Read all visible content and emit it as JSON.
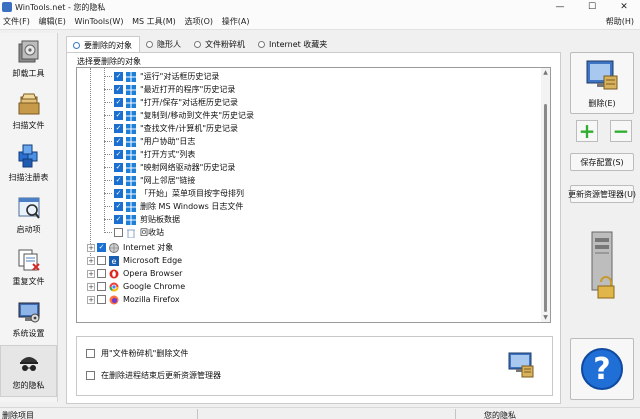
{
  "window": {
    "title": "WinTools.net - 您的隐私",
    "min": "—",
    "max": "☐",
    "close": "✕"
  },
  "menu": {
    "items": [
      "文件(F)",
      "编辑(E)",
      "WinTools(W)",
      "MS 工具(M)",
      "选项(O)",
      "操作(A)"
    ],
    "help": "帮助(H)"
  },
  "sidebar": {
    "items": [
      {
        "label": "卸载工具",
        "icon": "uninstall-icon"
      },
      {
        "label": "扫描文件",
        "icon": "scan-files-icon"
      },
      {
        "label": "扫描注册表",
        "icon": "scan-registry-icon"
      },
      {
        "label": "启动项",
        "icon": "startup-icon"
      },
      {
        "label": "重复文件",
        "icon": "duplicate-files-icon"
      },
      {
        "label": "系统设置",
        "icon": "system-settings-icon"
      },
      {
        "label": "您的隐私",
        "icon": "privacy-icon"
      }
    ]
  },
  "tabs": [
    {
      "label": "要删除的对象",
      "active": true
    },
    {
      "label": "隐形人",
      "active": false
    },
    {
      "label": "文件粉碎机",
      "active": false
    },
    {
      "label": "Internet 收藏夹",
      "active": false
    }
  ],
  "group_title": "选择要删除的对象",
  "tree": {
    "windows_items": [
      {
        "label": "\"运行\"对话框历史记录",
        "checked": true
      },
      {
        "label": "\"最近打开的程序\"历史记录",
        "checked": true
      },
      {
        "label": "\"打开/保存\"对话框历史记录",
        "checked": true
      },
      {
        "label": "\"复制到/移动到文件夹\"历史记录",
        "checked": true
      },
      {
        "label": "\"查找文件/计算机\"历史记录",
        "checked": true
      },
      {
        "label": "\"用户协助\"日志",
        "checked": true
      },
      {
        "label": "\"打开方式\"列表",
        "checked": true
      },
      {
        "label": "\"映射网络驱动器\"历史记录",
        "checked": true
      },
      {
        "label": "\"网上邻居\"链接",
        "checked": true
      },
      {
        "label": "「开始」菜单项目按字母排列",
        "checked": true
      },
      {
        "label": "删除 MS Windows 日志文件",
        "checked": true
      },
      {
        "label": "剪贴板数据",
        "checked": true
      },
      {
        "label": "回收站",
        "checked": false
      }
    ],
    "browsers": [
      {
        "label": "Internet 对象",
        "checked": true,
        "icon": "internet-objects-icon"
      },
      {
        "label": "Microsoft Edge",
        "checked": false,
        "icon": "edge-icon"
      },
      {
        "label": "Opera Browser",
        "checked": false,
        "icon": "opera-icon"
      },
      {
        "label": "Google Chrome",
        "checked": false,
        "icon": "chrome-icon"
      },
      {
        "label": "Mozilla Firefox",
        "checked": false,
        "icon": "firefox-icon"
      }
    ],
    "checkmark": "✓"
  },
  "options": [
    {
      "label": "用\"文件粉碎机\"删除文件",
      "checked": false
    },
    {
      "label": "在删除进程结束后更新资源管理器",
      "checked": false
    }
  ],
  "right": {
    "delete_label": "删除(E)",
    "add_symbol": "+",
    "remove_symbol": "−",
    "save_config": "保存配置(S)",
    "update_explorer": "更新资源管理器(U)",
    "help_symbol": "?"
  },
  "status": {
    "left": "删除项目",
    "right": "您的隐私"
  },
  "colors": {
    "accent": "#1a6fd0",
    "green": "#2fae2f",
    "help_blue": "#1f6fd6"
  }
}
